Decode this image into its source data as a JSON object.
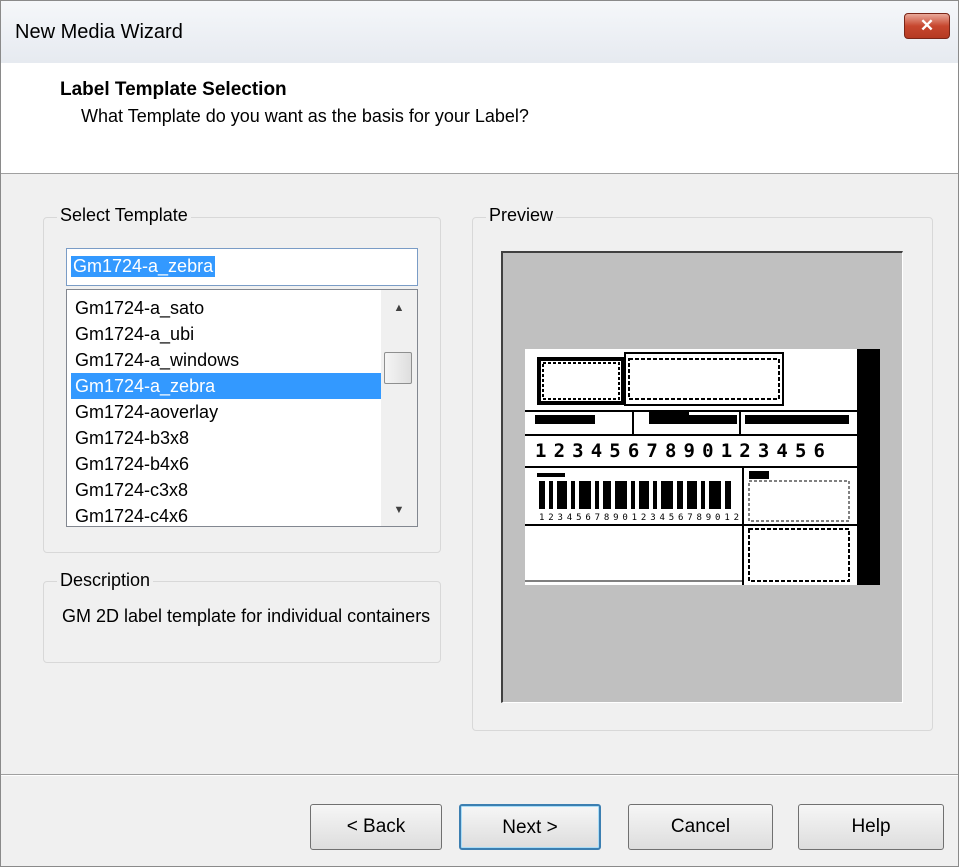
{
  "window": {
    "title": "New Media Wizard",
    "close_label": "✕"
  },
  "header": {
    "title": "Label Template Selection",
    "subtitle": "What Template do you want as the basis for your Label?"
  },
  "select_template": {
    "group_label": "Select Template",
    "input_value": "Gm1724-a_zebra",
    "items": [
      {
        "label": "Gm1724-a_sato",
        "selected": false
      },
      {
        "label": "Gm1724-a_ubi",
        "selected": false
      },
      {
        "label": "Gm1724-a_windows",
        "selected": false
      },
      {
        "label": "Gm1724-a_zebra",
        "selected": true
      },
      {
        "label": "Gm1724-aoverlay",
        "selected": false
      },
      {
        "label": "Gm1724-b3x8",
        "selected": false
      },
      {
        "label": "Gm1724-b4x6",
        "selected": false
      },
      {
        "label": "Gm1724-c3x8",
        "selected": false
      },
      {
        "label": "Gm1724-c4x6",
        "selected": false
      }
    ],
    "scroll_up_icon": "triangle-up-icon",
    "scroll_down_icon": "triangle-down-icon"
  },
  "description": {
    "group_label": "Description",
    "text": "GM 2D label template for individual containers"
  },
  "preview": {
    "group_label": "Preview",
    "barcode_number": "1234567890123456",
    "barcode_caption": "1234567890123456789012"
  },
  "buttons": {
    "back": "< Back",
    "next": "Next >",
    "cancel": "Cancel",
    "help": "Help"
  }
}
